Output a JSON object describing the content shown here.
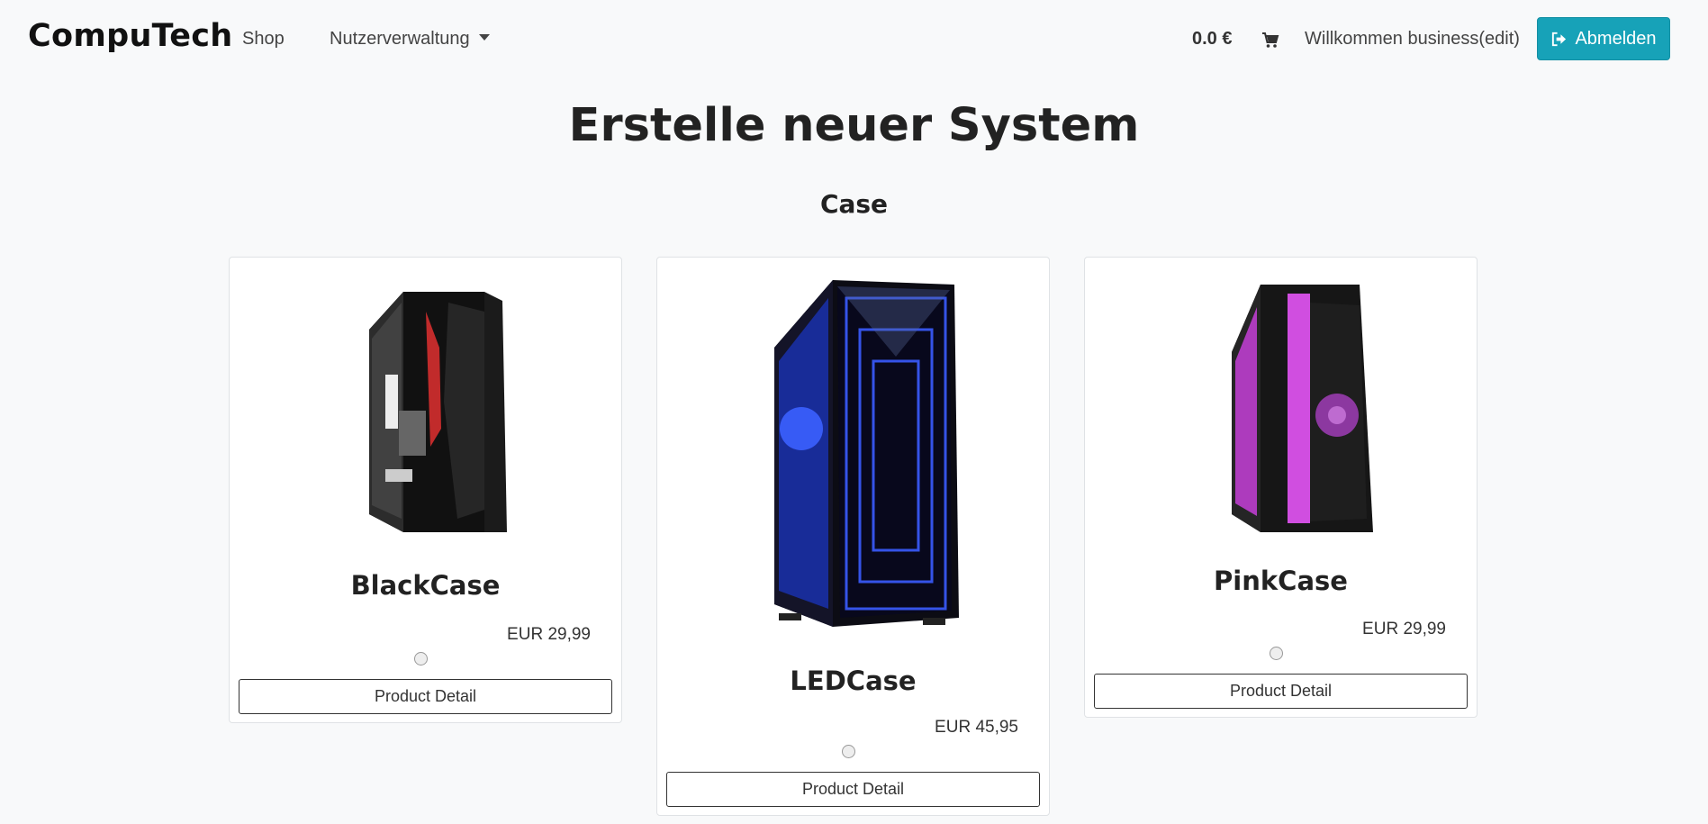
{
  "nav": {
    "brand": "CompuTech",
    "shop": "Shop",
    "users": "Nutzerverwaltung",
    "cart_total": "0.0 €",
    "welcome": "Willkommen business(edit)",
    "logout": "Abmelden"
  },
  "page": {
    "title": "Erstelle neuer System",
    "section": "Case"
  },
  "products": [
    {
      "name": "BlackCase",
      "price": "EUR 29,99",
      "detail": "Product Detail",
      "accent": "#e03030"
    },
    {
      "name": "LEDCase",
      "price": "EUR 45,95",
      "detail": "Product Detail",
      "accent": "#2a4bff"
    },
    {
      "name": "PinkCase",
      "price": "EUR 29,99",
      "detail": "Product Detail",
      "accent": "#d04ee0"
    }
  ],
  "colors": {
    "primary_button": "#17a2b8",
    "background": "#f8f9fa"
  }
}
